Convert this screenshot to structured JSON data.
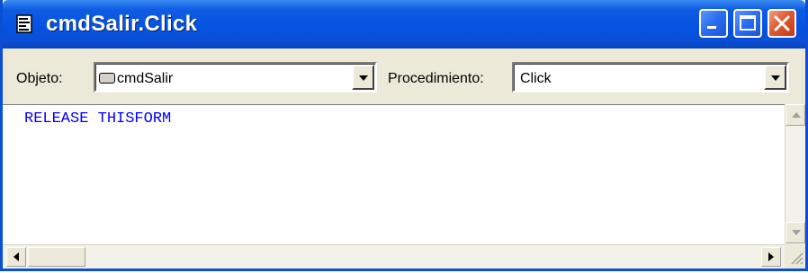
{
  "window": {
    "title": "cmdSalir.Click"
  },
  "toolbar": {
    "object_label": "Objeto:",
    "object_value": "cmdSalir",
    "procedure_label": "Procedimiento:",
    "procedure_value": "Click"
  },
  "code": {
    "lines": [
      "RELEASE THISFORM"
    ]
  },
  "colors": {
    "titlebar": "#0553e1",
    "code_text": "#0000ff",
    "window_face": "#ece9d8"
  },
  "icons": [
    "code-window-icon",
    "minimize-icon",
    "maximize-icon",
    "close-icon",
    "chevron-down-icon",
    "scroll-up-icon",
    "scroll-down-icon",
    "scroll-left-icon",
    "scroll-right-icon"
  ]
}
